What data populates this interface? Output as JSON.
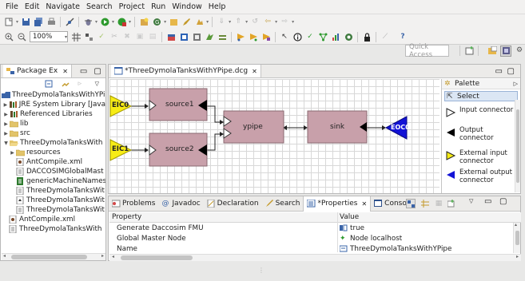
{
  "menu": [
    "File",
    "Edit",
    "Navigate",
    "Search",
    "Project",
    "Run",
    "Window",
    "Help"
  ],
  "toolbar": {
    "zoom_value": "100%"
  },
  "quick_access": {
    "placeholder": "Quick Access"
  },
  "package_explorer": {
    "tab_label": "Package Ex",
    "items": [
      {
        "label": "ThreeDymolaTanksWithYPipe",
        "level": 0
      },
      {
        "label": "JRE System Library [Java",
        "level": 1
      },
      {
        "label": "Referenced Libraries",
        "level": 1
      },
      {
        "label": "lib",
        "level": 1
      },
      {
        "label": "src",
        "level": 1
      },
      {
        "label": "ThreeDymolaTanksWith",
        "level": 1
      },
      {
        "label": "resources",
        "level": 2
      },
      {
        "label": "AntCompile.xml",
        "level": 2
      },
      {
        "label": "DACCOSIMGlobalMast",
        "level": 2
      },
      {
        "label": "genericMachineNames",
        "level": 2
      },
      {
        "label": "ThreeDymolaTanksWit",
        "level": 2
      },
      {
        "label": "ThreeDymolaTanksWit",
        "level": 2
      },
      {
        "label": "ThreeDymolaTanksWit",
        "level": 2
      },
      {
        "label": "AntCompile.xml",
        "level": 1
      },
      {
        "label": "ThreeDymolaTanksWith",
        "level": 1
      }
    ]
  },
  "editor": {
    "tab_label": "*ThreeDymolaTanksWithYPipe.dcg"
  },
  "diagram": {
    "nodes": {
      "eic0": "EIC0",
      "eic1": "EIC1",
      "source1": "source1",
      "source2": "source2",
      "ypipe": "ypipe",
      "sink": "sink",
      "eoc0": "EOC0"
    }
  },
  "palette": {
    "title": "Palette",
    "select": "Select",
    "items": [
      {
        "label": "Input connector"
      },
      {
        "label": "Output connector"
      },
      {
        "label": "External input connector"
      },
      {
        "label": "External output connector"
      }
    ]
  },
  "bottom_tabs": [
    "Problems",
    "Javadoc",
    "Declaration",
    "Search",
    "*Properties",
    "Console"
  ],
  "properties": {
    "col_property": "Property",
    "col_value": "Value",
    "rows": [
      {
        "key": "Generate Daccosim FMU",
        "value": "true"
      },
      {
        "key": "Global Master Node",
        "value": "Node localhost"
      },
      {
        "key": "Name",
        "value": "ThreeDymolaTanksWithYPipe"
      }
    ]
  },
  "colors": {
    "block": "#c8a0aa",
    "external_input": "#f7ec15",
    "external_output": "#1313d6",
    "accent": "#3b7fd1"
  }
}
